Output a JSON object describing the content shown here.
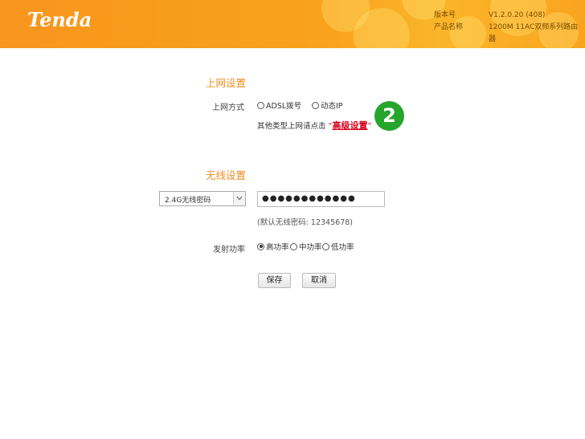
{
  "header": {
    "logo": "Tenda",
    "version_label": "版本号",
    "version_value": "V1.2.0.20 (408)",
    "product_label": "产品名称",
    "product_value": "1200M 11AC双频系列路由器"
  },
  "internet": {
    "title": "上网设置",
    "mode_label": "上网方式",
    "options": [
      "ADSL拨号",
      "动态IP"
    ],
    "other_prefix": "其他类型上网请点击",
    "quote_open": "“",
    "advanced_link": "高级设置",
    "quote_close": "”",
    "step_number": "2"
  },
  "wireless": {
    "title": "无线设置",
    "band_select": "2.4G无线密码",
    "password_mask": "●●●●●●●●●●●●",
    "default_hint": "(默认无线密码: 12345678)",
    "power_label": "发射功率",
    "power_options": [
      "高功率",
      "中功率",
      "低功率"
    ],
    "power_selected": "高功率"
  },
  "buttons": {
    "save": "保存",
    "cancel": "取消"
  },
  "colors": {
    "header_orange": "#f7951d",
    "section_title": "#f08c1e",
    "link_red": "#d6001c",
    "badge_green": "#26a52c"
  }
}
